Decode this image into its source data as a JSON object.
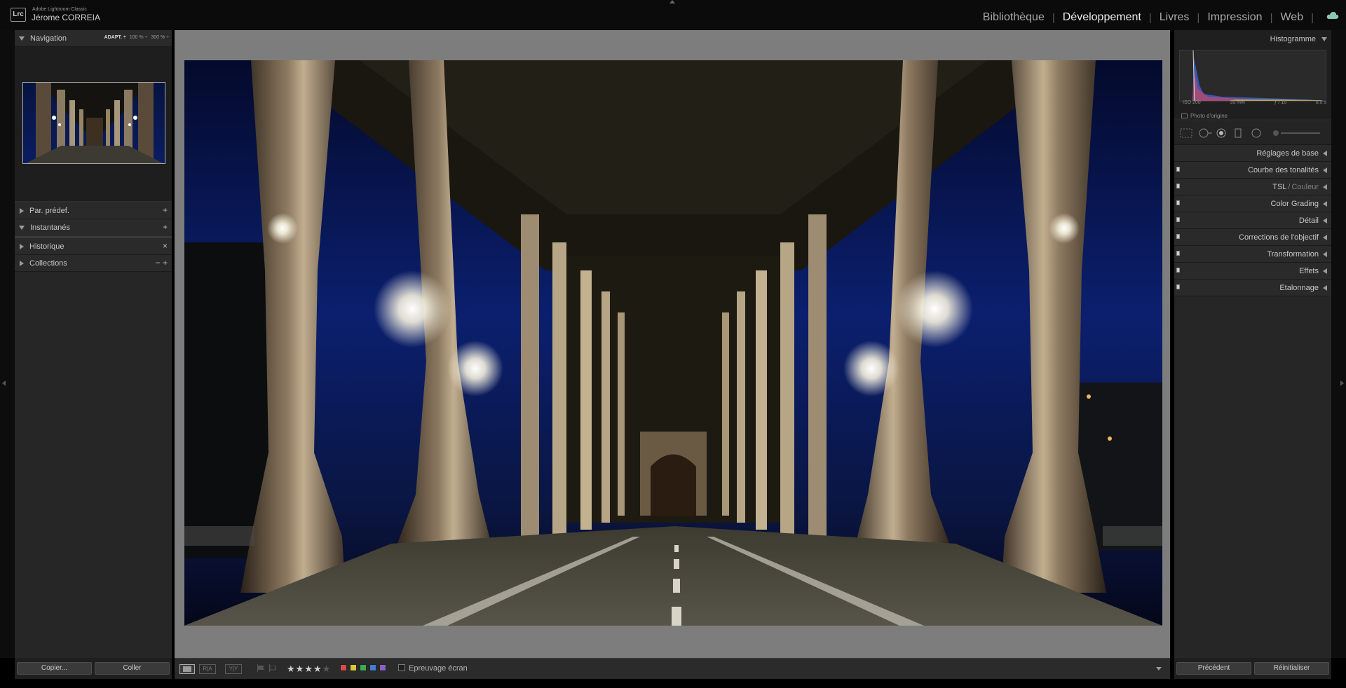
{
  "app": {
    "badge": "Lrc",
    "name": "Adobe Lightroom Classic",
    "user": "Jérome CORREIA"
  },
  "modules": [
    {
      "label": "Bibliothèque",
      "active": false
    },
    {
      "label": "Développement",
      "active": true
    },
    {
      "label": "Livres",
      "active": false
    },
    {
      "label": "Impression",
      "active": false
    },
    {
      "label": "Web",
      "active": false
    }
  ],
  "left_panel": {
    "navigation": {
      "title": "Navigation",
      "zoom_options": [
        "ADAPT. ÷",
        "100 % ÷",
        "300 % ÷"
      ]
    },
    "sections": [
      {
        "title": "Par. prédef.",
        "action": "+",
        "expanded": false
      },
      {
        "title": "Instantanés",
        "action": "+",
        "expanded": true
      },
      {
        "title": "Historique",
        "action": "×",
        "expanded": false
      },
      {
        "title": "Collections",
        "action": "−  +",
        "expanded": false
      }
    ],
    "footer": {
      "copy_label": "Copier...",
      "paste_label": "Coller"
    }
  },
  "toolbar": {
    "view_ba": "R|A",
    "view_yy": "Y|Y",
    "rating": 4,
    "rating_max": 5,
    "color_labels": [
      "#d94a4a",
      "#d9c63a",
      "#3eab4c",
      "#3f7fd6",
      "#8a5fc7"
    ],
    "softproof_label": "Epreuvage écran"
  },
  "right_panel": {
    "histogram": {
      "title": "Histogramme",
      "iso": "ISO 200",
      "focal": "35 mm",
      "aperture": "ƒ / 16",
      "shutter": "8,0 s",
      "original_photo": "Photo d'origine"
    },
    "sections": [
      {
        "title": "Réglages de base",
        "switch": false
      },
      {
        "title": "Courbe des tonalités",
        "switch": true
      },
      {
        "title_main": "TSL",
        "title_sep": "/",
        "title_dim": "Couleur",
        "switch": true
      },
      {
        "title": "Color Grading",
        "switch": true
      },
      {
        "title": "Détail",
        "switch": true
      },
      {
        "title": "Corrections de l'objectif",
        "switch": true
      },
      {
        "title": "Transformation",
        "switch": true
      },
      {
        "title": "Effets",
        "switch": true
      },
      {
        "title": "Etalonnage",
        "switch": true
      }
    ],
    "footer": {
      "previous_label": "Précédent",
      "reset_label": "Réinitialiser"
    }
  }
}
